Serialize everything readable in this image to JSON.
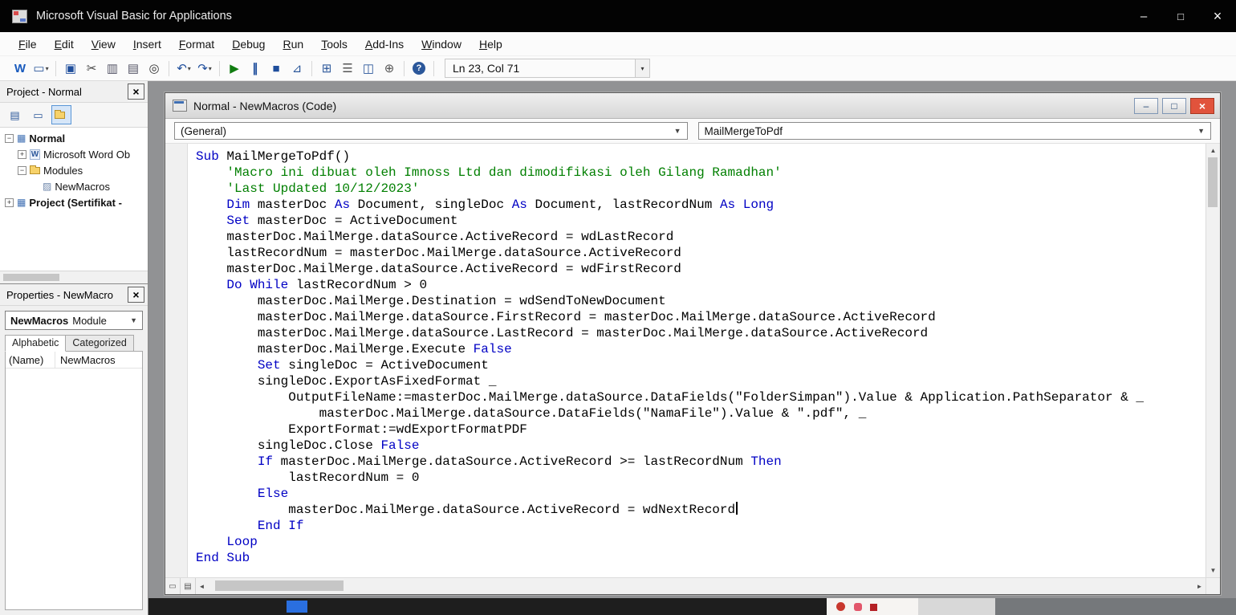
{
  "titlebar": {
    "title": "Microsoft Visual Basic for Applications"
  },
  "window_controls": {
    "minimize": "–",
    "maximize": "□",
    "close": "×"
  },
  "icons": {
    "dropdown": "▼",
    "small_dropdown": "▾",
    "up_arrow": "▲",
    "down_arrow": "▼",
    "left_arrow": "◄",
    "right_arrow": "►",
    "procedure_view": "▭",
    "module_view": "▤"
  },
  "menu": {
    "items": [
      "File",
      "Edit",
      "View",
      "Insert",
      "Format",
      "Debug",
      "Run",
      "Tools",
      "Add-Ins",
      "Window",
      "Help"
    ]
  },
  "toolbar": {
    "position_indicator": "Ln 23, Col 71",
    "buttons": [
      {
        "name": "view-microsoft-word-icon",
        "glyph": "W",
        "color": "#185abd",
        "bold": true
      },
      {
        "name": "insert-userform-icon",
        "glyph": "▭",
        "color": "#2b579a",
        "dropdown": true
      },
      {
        "sep": true
      },
      {
        "name": "save-icon",
        "glyph": "▣",
        "color": "#1f4e9c"
      },
      {
        "name": "cut-icon",
        "glyph": "✂",
        "color": "#444444"
      },
      {
        "name": "copy-icon",
        "glyph": "▥",
        "color": "#555566"
      },
      {
        "name": "paste-icon",
        "glyph": "▤",
        "color": "#555566"
      },
      {
        "name": "find-icon",
        "glyph": "◎",
        "color": "#333333"
      },
      {
        "sep": true
      },
      {
        "name": "undo-icon",
        "glyph": "↶",
        "color": "#1f4e9c",
        "dropdown": true
      },
      {
        "name": "redo-icon",
        "glyph": "↷",
        "color": "#1f4e9c",
        "dropdown": true
      },
      {
        "sep": true
      },
      {
        "name": "run-icon",
        "glyph": "▶",
        "color": "#107c10"
      },
      {
        "name": "break-icon",
        "glyph": "∥",
        "color": "#1f4e9c",
        "bold": true
      },
      {
        "name": "reset-icon",
        "glyph": "■",
        "color": "#1f4e9c"
      },
      {
        "name": "design-mode-icon",
        "glyph": "⊿",
        "color": "#2b579a"
      },
      {
        "sep": true
      },
      {
        "name": "project-explorer-icon",
        "glyph": "⊞",
        "color": "#2b579a"
      },
      {
        "name": "properties-window-icon",
        "glyph": "☰",
        "color": "#555555"
      },
      {
        "name": "object-browser-icon",
        "glyph": "◫",
        "color": "#2b579a"
      },
      {
        "name": "toolbox-icon",
        "glyph": "⊕",
        "color": "#555555"
      },
      {
        "sep": true
      },
      {
        "name": "help-icon",
        "glyph": "?",
        "color": "#ffffff"
      }
    ]
  },
  "project_panel": {
    "title": "Project - Normal",
    "tools": [
      {
        "name": "view-code-icon",
        "glyph": "▤"
      },
      {
        "name": "view-object-icon",
        "glyph": "▭"
      },
      {
        "name": "toggle-folders-icon",
        "glyph": "folder",
        "pressed": true
      }
    ],
    "tree": [
      {
        "label": "Normal",
        "level": 0,
        "expander": "-",
        "icon": "project",
        "bold": true
      },
      {
        "label": "Microsoft Word Ob",
        "level": 1,
        "expander": "+",
        "icon": "word",
        "bold": false
      },
      {
        "label": "Modules",
        "level": 1,
        "expander": "-",
        "icon": "folder",
        "bold": false
      },
      {
        "label": "NewMacros",
        "level": 2,
        "expander": null,
        "icon": "module",
        "bold": false
      },
      {
        "label": "Project (Sertifikat -",
        "level": 0,
        "expander": "+",
        "icon": "project",
        "bold": true
      }
    ]
  },
  "properties_panel": {
    "title": "Properties - NewMacro",
    "object_name": "NewMacros",
    "object_type": "Module",
    "tabs": [
      "Alphabetic",
      "Categorized"
    ],
    "active_tab": "Alphabetic",
    "rows": [
      {
        "name": "(Name)",
        "value": "NewMacros"
      }
    ]
  },
  "code_window": {
    "title": "Normal - NewMacros (Code)",
    "object_dropdown": "(General)",
    "procedure_dropdown": "MailMergeToPdf",
    "controls": {
      "minimize": "–",
      "maximize": "□",
      "close": "×"
    },
    "colors": {
      "keyword": "#0000c4",
      "comment": "#007f00",
      "text": "#000000"
    },
    "cursor_line": 22,
    "lines": [
      [
        [
          "k",
          "Sub"
        ],
        [
          "n",
          " MailMergeToPdf()"
        ]
      ],
      [
        [
          "c",
          "    'Macro ini dibuat oleh Imnoss Ltd dan dimodifikasi oleh Gilang Ramadhan'"
        ]
      ],
      [
        [
          "c",
          "    'Last Updated 10/12/2023'"
        ]
      ],
      [
        [
          "n",
          "    "
        ],
        [
          "k",
          "Dim"
        ],
        [
          "n",
          " masterDoc "
        ],
        [
          "k",
          "As"
        ],
        [
          "n",
          " Document, singleDoc "
        ],
        [
          "k",
          "As"
        ],
        [
          "n",
          " Document, lastRecordNum "
        ],
        [
          "k",
          "As"
        ],
        [
          "n",
          " "
        ],
        [
          "k",
          "Long"
        ]
      ],
      [
        [
          "n",
          "    "
        ],
        [
          "k",
          "Set"
        ],
        [
          "n",
          " masterDoc = ActiveDocument"
        ]
      ],
      [
        [
          "n",
          "    masterDoc.MailMerge.dataSource.ActiveRecord = wdLastRecord"
        ]
      ],
      [
        [
          "n",
          "    lastRecordNum = masterDoc.MailMerge.dataSource.ActiveRecord"
        ]
      ],
      [
        [
          "n",
          "    masterDoc.MailMerge.dataSource.ActiveRecord = wdFirstRecord"
        ]
      ],
      [
        [
          "n",
          "    "
        ],
        [
          "k",
          "Do While"
        ],
        [
          "n",
          " lastRecordNum > 0"
        ]
      ],
      [
        [
          "n",
          "        masterDoc.MailMerge.Destination = wdSendToNewDocument"
        ]
      ],
      [
        [
          "n",
          "        masterDoc.MailMerge.dataSource.FirstRecord = masterDoc.MailMerge.dataSource.ActiveRecord"
        ]
      ],
      [
        [
          "n",
          "        masterDoc.MailMerge.dataSource.LastRecord = masterDoc.MailMerge.dataSource.ActiveRecord"
        ]
      ],
      [
        [
          "n",
          "        masterDoc.MailMerge.Execute "
        ],
        [
          "k",
          "False"
        ]
      ],
      [
        [
          "n",
          "        "
        ],
        [
          "k",
          "Set"
        ],
        [
          "n",
          " singleDoc = ActiveDocument"
        ]
      ],
      [
        [
          "n",
          "        singleDoc.ExportAsFixedFormat _"
        ]
      ],
      [
        [
          "n",
          "            OutputFileName:=masterDoc.MailMerge.dataSource.DataFields(\"FolderSimpan\").Value & Application.PathSeparator & _"
        ]
      ],
      [
        [
          "n",
          "                masterDoc.MailMerge.dataSource.DataFields(\"NamaFile\").Value & \".pdf\", _"
        ]
      ],
      [
        [
          "n",
          "            ExportFormat:=wdExportFormatPDF"
        ]
      ],
      [
        [
          "n",
          "        singleDoc.Close "
        ],
        [
          "k",
          "False"
        ]
      ],
      [
        [
          "n",
          "        "
        ],
        [
          "k",
          "If"
        ],
        [
          "n",
          " masterDoc.MailMerge.dataSource.ActiveRecord >= lastRecordNum "
        ],
        [
          "k",
          "Then"
        ]
      ],
      [
        [
          "n",
          "            lastRecordNum = 0"
        ]
      ],
      [
        [
          "n",
          "        "
        ],
        [
          "k",
          "Else"
        ]
      ],
      [
        [
          "n",
          "            masterDoc.MailMerge.dataSource.ActiveRecord = wdNextRecord"
        ]
      ],
      [
        [
          "n",
          "        "
        ],
        [
          "k",
          "End If"
        ]
      ],
      [
        [
          "n",
          "    "
        ],
        [
          "k",
          "Loop"
        ]
      ],
      [
        [
          "k",
          "End Sub"
        ]
      ]
    ]
  }
}
